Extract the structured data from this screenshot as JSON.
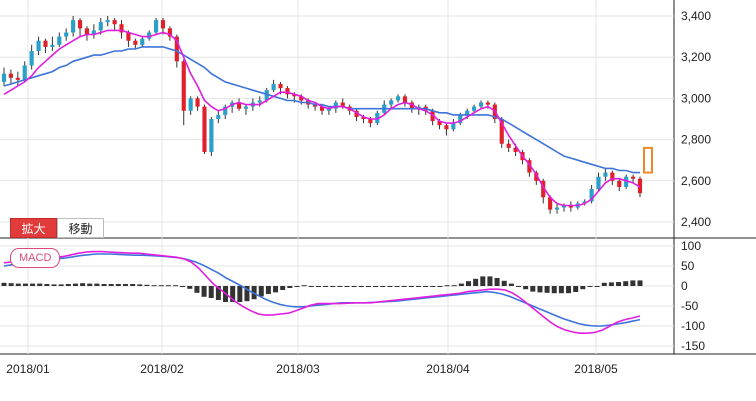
{
  "buttons": {
    "expand_label": "拡大",
    "move_label": "移動"
  },
  "macd_label": "MACD",
  "chart_data": [
    {
      "type": "candlestick",
      "name_hidden": true,
      "x_ticks": [
        "2018/01",
        "2018/02",
        "2018/03",
        "2018/04",
        "2018/05"
      ],
      "y_ticks": [
        "3,400",
        "3,200",
        "3,000",
        "2,800",
        "2,600",
        "2,400"
      ],
      "ylim": [
        2350,
        3450
      ],
      "colors": {
        "up": "#2aa0c8",
        "down": "#e0202a",
        "ma_short": "#e11ee0",
        "ma_long": "#3d74d9",
        "current": "#f08a28"
      },
      "candles": [
        [
          3080,
          3120,
          3060,
          3150
        ],
        [
          3120,
          3100,
          3070,
          3140
        ],
        [
          3100,
          3090,
          3060,
          3130
        ],
        [
          3090,
          3160,
          3080,
          3180
        ],
        [
          3160,
          3230,
          3140,
          3260
        ],
        [
          3230,
          3280,
          3210,
          3300
        ],
        [
          3280,
          3250,
          3220,
          3290
        ],
        [
          3250,
          3260,
          3230,
          3300
        ],
        [
          3260,
          3300,
          3250,
          3320
        ],
        [
          3300,
          3320,
          3280,
          3340
        ],
        [
          3320,
          3380,
          3300,
          3400
        ],
        [
          3380,
          3340,
          3300,
          3390
        ],
        [
          3340,
          3310,
          3280,
          3350
        ],
        [
          3310,
          3330,
          3290,
          3360
        ],
        [
          3330,
          3370,
          3310,
          3390
        ],
        [
          3370,
          3380,
          3350,
          3400
        ],
        [
          3380,
          3360,
          3330,
          3390
        ],
        [
          3360,
          3320,
          3290,
          3380
        ],
        [
          3320,
          3280,
          3250,
          3330
        ],
        [
          3280,
          3260,
          3240,
          3290
        ],
        [
          3260,
          3290,
          3250,
          3300
        ],
        [
          3290,
          3320,
          3280,
          3330
        ],
        [
          3320,
          3380,
          3310,
          3390
        ],
        [
          3380,
          3340,
          3310,
          3390
        ],
        [
          3340,
          3300,
          3280,
          3350
        ],
        [
          3300,
          3180,
          3150,
          3310
        ],
        [
          3180,
          2940,
          2870,
          3190
        ],
        [
          2940,
          3000,
          2920,
          3010
        ],
        [
          3000,
          2960,
          2940,
          3010
        ],
        [
          2960,
          2740,
          2730,
          2970
        ],
        [
          2740,
          2900,
          2720,
          2910
        ],
        [
          2900,
          2920,
          2880,
          2940
        ],
        [
          2920,
          2960,
          2900,
          2970
        ],
        [
          2960,
          2980,
          2930,
          2990
        ],
        [
          2980,
          2950,
          2940,
          3000
        ],
        [
          2950,
          2960,
          2920,
          2970
        ],
        [
          2960,
          2980,
          2940,
          3000
        ],
        [
          2980,
          2990,
          2960,
          3010
        ],
        [
          2990,
          3040,
          2980,
          3050
        ],
        [
          3040,
          3070,
          3030,
          3090
        ],
        [
          3070,
          3050,
          3020,
          3080
        ],
        [
          3050,
          3020,
          3000,
          3060
        ],
        [
          3020,
          3010,
          2980,
          3030
        ],
        [
          3010,
          2990,
          2970,
          3020
        ],
        [
          2990,
          2970,
          2950,
          3000
        ],
        [
          2970,
          2960,
          2940,
          2980
        ],
        [
          2960,
          2940,
          2920,
          2970
        ],
        [
          2940,
          2950,
          2920,
          2960
        ],
        [
          2950,
          2980,
          2930,
          2990
        ],
        [
          2980,
          2960,
          2950,
          3000
        ],
        [
          2960,
          2940,
          2920,
          2970
        ],
        [
          2940,
          2910,
          2890,
          2950
        ],
        [
          2910,
          2900,
          2880,
          2920
        ],
        [
          2900,
          2880,
          2860,
          2910
        ],
        [
          2880,
          2930,
          2870,
          2940
        ],
        [
          2930,
          2970,
          2920,
          2990
        ],
        [
          2970,
          2990,
          2950,
          3000
        ],
        [
          2990,
          3010,
          2980,
          3020
        ],
        [
          3010,
          2980,
          2960,
          3020
        ],
        [
          2980,
          2950,
          2930,
          2990
        ],
        [
          2950,
          2960,
          2920,
          2970
        ],
        [
          2960,
          2940,
          2920,
          2970
        ],
        [
          2940,
          2890,
          2870,
          2950
        ],
        [
          2890,
          2870,
          2850,
          2900
        ],
        [
          2870,
          2850,
          2820,
          2880
        ],
        [
          2850,
          2880,
          2840,
          2900
        ],
        [
          2880,
          2920,
          2870,
          2930
        ],
        [
          2920,
          2940,
          2900,
          2950
        ],
        [
          2940,
          2960,
          2930,
          2970
        ],
        [
          2960,
          2980,
          2950,
          2990
        ],
        [
          2980,
          2970,
          2950,
          2990
        ],
        [
          2970,
          2900,
          2880,
          2980
        ],
        [
          2900,
          2780,
          2760,
          2910
        ],
        [
          2780,
          2760,
          2740,
          2800
        ],
        [
          2760,
          2740,
          2720,
          2780
        ],
        [
          2740,
          2700,
          2680,
          2750
        ],
        [
          2700,
          2640,
          2620,
          2710
        ],
        [
          2640,
          2600,
          2580,
          2650
        ],
        [
          2600,
          2520,
          2490,
          2610
        ],
        [
          2520,
          2460,
          2440,
          2530
        ],
        [
          2460,
          2470,
          2440,
          2490
        ],
        [
          2470,
          2480,
          2450,
          2490
        ],
        [
          2480,
          2470,
          2450,
          2500
        ],
        [
          2470,
          2490,
          2460,
          2500
        ],
        [
          2490,
          2500,
          2480,
          2510
        ],
        [
          2500,
          2560,
          2490,
          2580
        ],
        [
          2560,
          2620,
          2550,
          2640
        ],
        [
          2620,
          2640,
          2600,
          2660
        ],
        [
          2640,
          2600,
          2580,
          2650
        ],
        [
          2600,
          2570,
          2550,
          2610
        ],
        [
          2570,
          2620,
          2560,
          2630
        ],
        [
          2620,
          2610,
          2590,
          2630
        ],
        [
          2610,
          2540,
          2520,
          2620
        ]
      ],
      "ma_short": [
        3020,
        3040,
        3060,
        3080,
        3110,
        3150,
        3180,
        3210,
        3240,
        3260,
        3280,
        3300,
        3310,
        3310,
        3320,
        3330,
        3330,
        3330,
        3320,
        3310,
        3300,
        3300,
        3310,
        3320,
        3310,
        3280,
        3200,
        3120,
        3060,
        2990,
        2960,
        2940,
        2950,
        2970,
        2980,
        2970,
        2970,
        2970,
        2990,
        3010,
        3030,
        3030,
        3020,
        3010,
        2990,
        2980,
        2960,
        2950,
        2960,
        2960,
        2950,
        2930,
        2910,
        2900,
        2900,
        2920,
        2950,
        2970,
        2980,
        2970,
        2950,
        2940,
        2920,
        2890,
        2880,
        2880,
        2890,
        2910,
        2930,
        2950,
        2960,
        2940,
        2880,
        2820,
        2770,
        2720,
        2680,
        2630,
        2570,
        2520,
        2490,
        2480,
        2480,
        2480,
        2490,
        2510,
        2550,
        2590,
        2610,
        2610,
        2600,
        2590,
        2570
      ],
      "ma_long": [
        3060,
        3070,
        3080,
        3090,
        3100,
        3110,
        3120,
        3130,
        3150,
        3160,
        3180,
        3190,
        3200,
        3210,
        3210,
        3220,
        3230,
        3230,
        3240,
        3240,
        3250,
        3250,
        3250,
        3250,
        3240,
        3230,
        3210,
        3190,
        3170,
        3150,
        3120,
        3100,
        3080,
        3070,
        3060,
        3050,
        3040,
        3030,
        3020,
        3010,
        3000,
        2990,
        2990,
        2980,
        2980,
        2970,
        2970,
        2960,
        2960,
        2960,
        2950,
        2950,
        2950,
        2950,
        2950,
        2950,
        2950,
        2950,
        2950,
        2950,
        2950,
        2950,
        2940,
        2930,
        2930,
        2920,
        2920,
        2920,
        2920,
        2920,
        2920,
        2910,
        2900,
        2880,
        2860,
        2840,
        2820,
        2800,
        2780,
        2760,
        2740,
        2720,
        2710,
        2700,
        2690,
        2680,
        2670,
        2660,
        2660,
        2650,
        2650,
        2640,
        2640
      ],
      "current_marker": [
        2640,
        2760
      ]
    },
    {
      "type": "macd",
      "y_ticks": [
        "100",
        "50",
        "0",
        "-50",
        "-100",
        "-150"
      ],
      "ylim": [
        -170,
        110
      ],
      "macd": [
        58,
        60,
        62,
        64,
        66,
        68,
        70,
        72,
        74,
        78,
        82,
        85,
        86,
        86,
        85,
        84,
        83,
        82,
        82,
        80,
        78,
        76,
        74,
        72,
        68,
        60,
        45,
        25,
        5,
        -10,
        -25,
        -40,
        -52,
        -62,
        -70,
        -73,
        -72,
        -70,
        -68,
        -62,
        -55,
        -48,
        -44,
        -44,
        -44,
        -44,
        -43,
        -42,
        -42,
        -42,
        -40,
        -38,
        -36,
        -34,
        -32,
        -30,
        -28,
        -26,
        -24,
        -22,
        -20,
        -18,
        -14,
        -12,
        -10,
        -8,
        -8,
        -10,
        -18,
        -30,
        -45,
        -60,
        -75,
        -90,
        -102,
        -110,
        -115,
        -118,
        -118,
        -116,
        -110,
        -100,
        -90,
        -84,
        -80,
        -75
      ],
      "signal": [
        50,
        53,
        56,
        58,
        60,
        62,
        65,
        68,
        70,
        73,
        76,
        78,
        80,
        80,
        80,
        79,
        78,
        77,
        77,
        76,
        75,
        74,
        72,
        70,
        66,
        60,
        52,
        42,
        32,
        20,
        10,
        0,
        -12,
        -22,
        -32,
        -40,
        -46,
        -50,
        -52,
        -52,
        -50,
        -48,
        -46,
        -44,
        -42,
        -42,
        -42,
        -42,
        -41,
        -40,
        -39,
        -38,
        -36,
        -34,
        -32,
        -30,
        -28,
        -26,
        -24,
        -22,
        -20,
        -18,
        -16,
        -14,
        -16,
        -20,
        -26,
        -34,
        -42,
        -50,
        -58,
        -66,
        -74,
        -82,
        -88,
        -94,
        -98,
        -100,
        -100,
        -98,
        -95,
        -92,
        -88,
        -84
      ],
      "histogram": [
        8,
        7,
        6,
        6,
        6,
        6,
        5,
        4,
        4,
        5,
        6,
        7,
        6,
        6,
        5,
        5,
        5,
        5,
        5,
        4,
        3,
        2,
        2,
        2,
        2,
        0,
        -7,
        -17,
        -27,
        -30,
        -35,
        -40,
        -40,
        -40,
        -38,
        -33,
        -26,
        -20,
        -16,
        -10,
        -5,
        0,
        2,
        0,
        -2,
        -2,
        -1,
        0,
        -1,
        -2,
        -1,
        0,
        0,
        0,
        0,
        0,
        0,
        0,
        0,
        0,
        0,
        0,
        2,
        2,
        6,
        12,
        18,
        24,
        24,
        20,
        13,
        6,
        -1,
        -8,
        -14,
        -16,
        -17,
        -18,
        -18,
        -18,
        -15,
        -8,
        -2,
        0,
        8,
        9,
        10,
        12,
        14,
        14
      ]
    }
  ]
}
